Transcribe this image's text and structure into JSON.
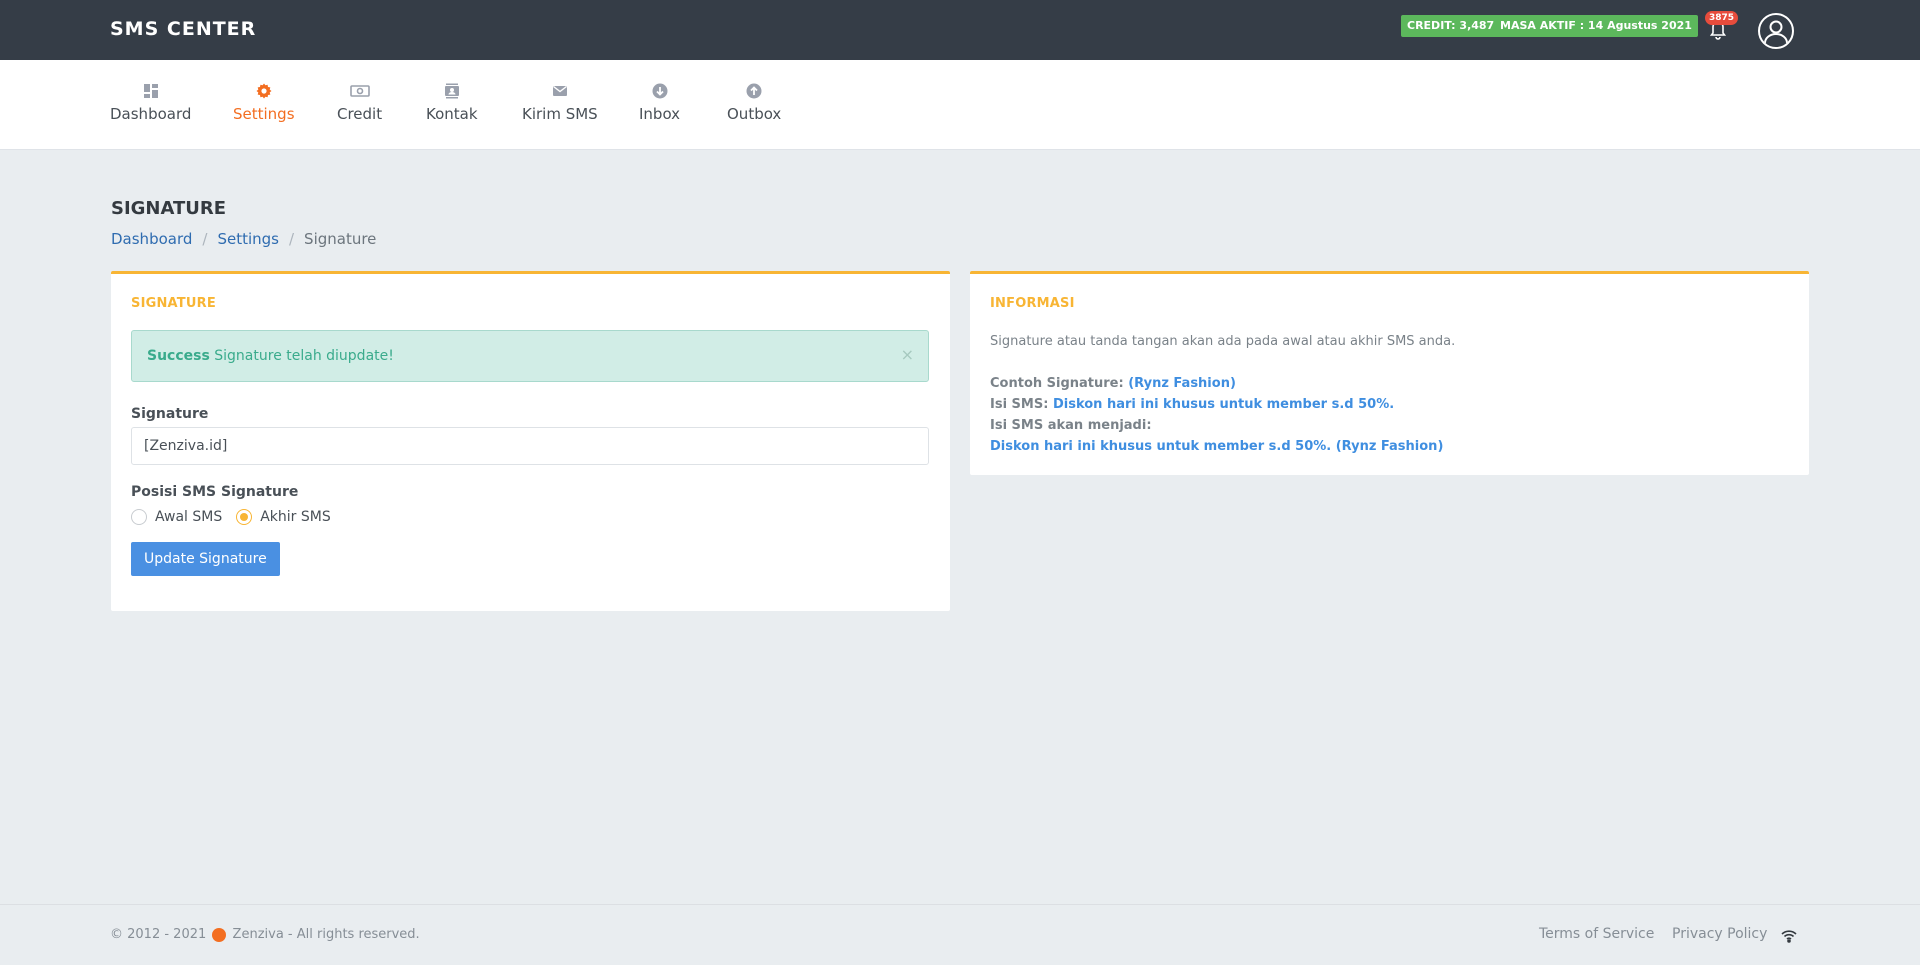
{
  "header": {
    "brand": "SMS CENTER",
    "credit_badge": "CREDIT: 3,487",
    "masa_badge": "MASA AKTIF : 14 Agustus 2021",
    "notification_count": "3875"
  },
  "nav": {
    "items": [
      {
        "label": "Dashboard",
        "icon": "dashboard-icon"
      },
      {
        "label": "Settings",
        "icon": "gear-icon",
        "active": true
      },
      {
        "label": "Credit",
        "icon": "money-icon"
      },
      {
        "label": "Kontak",
        "icon": "contact-icon"
      },
      {
        "label": "Kirim SMS",
        "icon": "envelope-icon"
      },
      {
        "label": "Inbox",
        "icon": "arrow-down-circle-icon"
      },
      {
        "label": "Outbox",
        "icon": "arrow-up-circle-icon"
      }
    ]
  },
  "page": {
    "title": "SIGNATURE",
    "breadcrumb": [
      "Dashboard",
      "Settings",
      "Signature"
    ]
  },
  "signature_card": {
    "title": "SIGNATURE",
    "alert_strong": "Success",
    "alert_message": "Signature telah diupdate!",
    "alert_close": "×",
    "signature_label": "Signature",
    "signature_value": "[Zenziva.id]",
    "position_label": "Posisi SMS Signature",
    "option_awal": "Awal SMS",
    "option_akhir": "Akhir SMS",
    "selected_position": "Akhir SMS",
    "submit_label": "Update Signature"
  },
  "info_card": {
    "title": "INFORMASI",
    "description": "Signature atau tanda tangan akan ada pada awal atau akhir SMS anda.",
    "example_label": "Contoh Signature:",
    "example_value": "(Rynz Fashion)",
    "sms_label": "Isi SMS:",
    "sms_value": "Diskon hari ini khusus untuk member s.d 50%.",
    "result_label": "Isi SMS akan menjadi:",
    "result_value": "Diskon hari ini khusus untuk member s.d 50%. (Rynz Fashion)"
  },
  "footer": {
    "copyright_prefix": "© 2012 - 2021",
    "copyright_suffix": "Zenziva - All rights reserved.",
    "terms": "Terms of Service",
    "privacy": "Privacy Policy"
  },
  "colors": {
    "topbar": "#353d47",
    "accent_orange": "#f36e21",
    "card_accent": "#f8b534",
    "badge_green": "#5cb85c",
    "button_blue": "#4a90e2",
    "link_blue": "#3f8ee0"
  }
}
